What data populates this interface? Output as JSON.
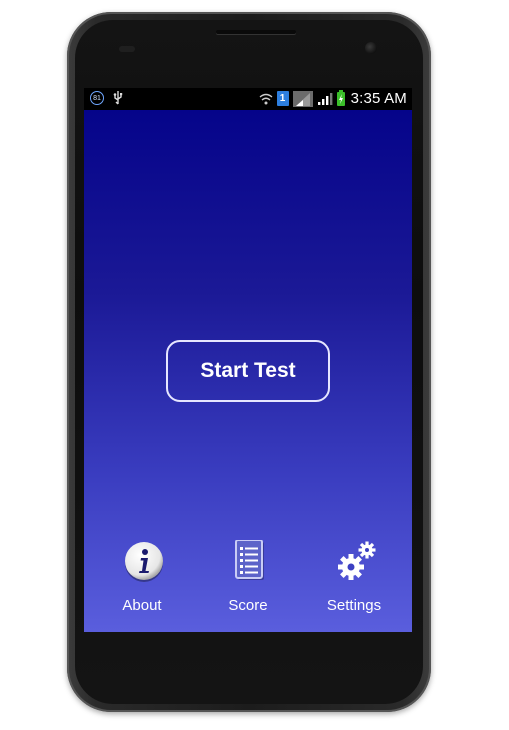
{
  "status_bar": {
    "notification_badge": "81",
    "sim_badge": "1",
    "time": "3:35 AM"
  },
  "main": {
    "start_label": "Start Test"
  },
  "nav": {
    "items": [
      {
        "label": "About",
        "icon": "info-icon"
      },
      {
        "label": "Score",
        "icon": "score-list-icon"
      },
      {
        "label": "Settings",
        "icon": "gears-icon"
      }
    ]
  },
  "colors": {
    "gradient_top": "#05048a",
    "gradient_bottom": "#5a5edd",
    "button_border": "#e6e6ff",
    "sim_blue": "#2d7fe0",
    "battery_green": "#3bbf2a"
  }
}
